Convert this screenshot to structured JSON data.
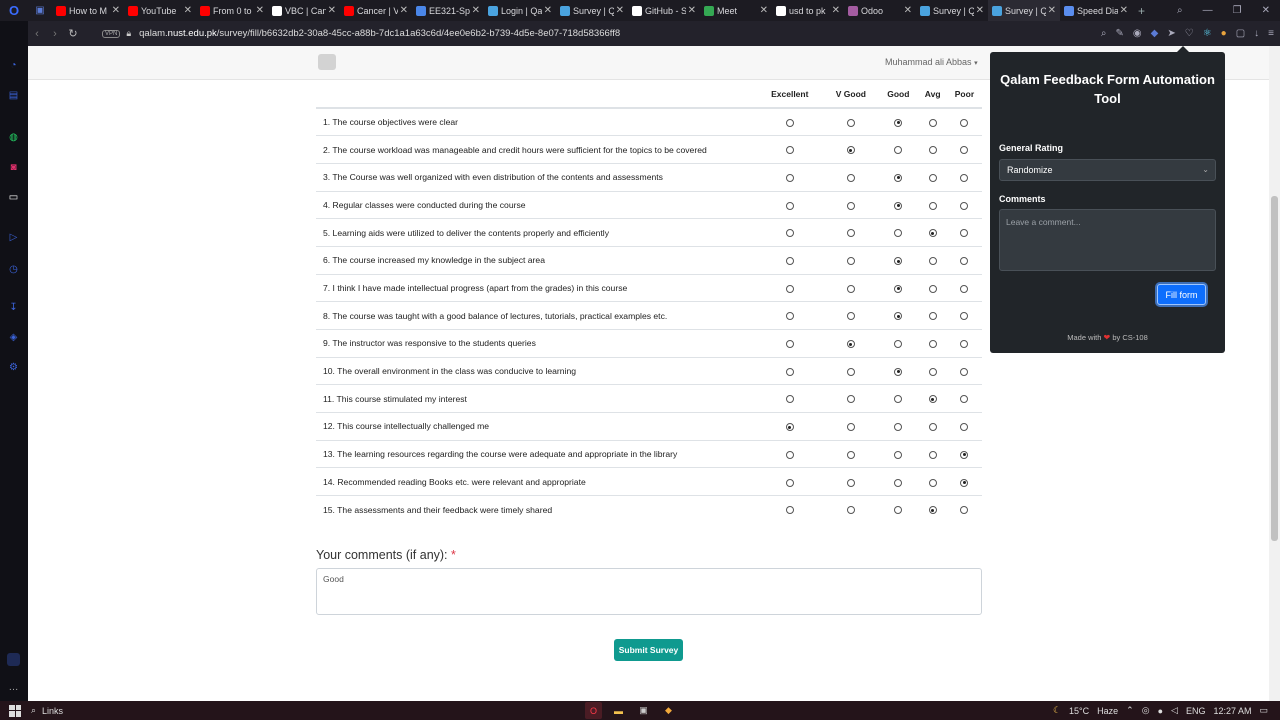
{
  "browser": {
    "tabs": [
      {
        "title": "How to M",
        "color": "#ff0000"
      },
      {
        "title": "YouTube",
        "color": "#ff0000"
      },
      {
        "title": "From 0 to",
        "color": "#ff0000"
      },
      {
        "title": "VBC | Can",
        "color": "#ffffff"
      },
      {
        "title": "Cancer | V",
        "color": "#ff0000"
      },
      {
        "title": "EE321-Sp",
        "color": "#4a86e8"
      },
      {
        "title": "Login | Qa",
        "color": "#4aa3df"
      },
      {
        "title": "Survey | Q",
        "color": "#4aa3df"
      },
      {
        "title": "GitHub - S",
        "color": "#ffffff"
      },
      {
        "title": "Meet",
        "color": "#34a853"
      },
      {
        "title": "usd to pk",
        "color": "#ffffff"
      },
      {
        "title": "Odoo",
        "color": "#a45ca1"
      },
      {
        "title": "Survey | Q",
        "color": "#4aa3df"
      },
      {
        "title": "Survey | Q",
        "color": "#4aa3df",
        "active": true
      },
      {
        "title": "Speed Dia",
        "color": "#5a8dee"
      }
    ],
    "url_prefix": "qalam.",
    "url_domain": "nust.edu.pk",
    "url_path": "/survey/fill/b6632db2-30a8-45cc-a88b-7dc1a1a63c6d/4ee0e6b2-b739-4d5e-8e07-718d58366ff8",
    "vpn_label": "VPN"
  },
  "page": {
    "user_name": "Muhammad ali Abbas",
    "columns": [
      "Excellent",
      "V Good",
      "Good",
      "Avg",
      "Poor"
    ],
    "questions": [
      {
        "text": "1. The course objectives were clear",
        "selected": 2
      },
      {
        "text": "2. The course workload was manageable and credit hours were sufficient for the topics to be covered",
        "selected": 1
      },
      {
        "text": "3. The Course was well organized with even distribution of the contents and assessments",
        "selected": 2
      },
      {
        "text": "4. Regular classes were conducted during the course",
        "selected": 2
      },
      {
        "text": "5. Learning aids were utilized to deliver the contents properly and efficiently",
        "selected": 3
      },
      {
        "text": "6. The course increased my knowledge in the subject area",
        "selected": 2
      },
      {
        "text": "7. I think I have made intellectual progress (apart from the grades) in this course",
        "selected": 2
      },
      {
        "text": "8. The course was taught with a good balance of lectures, tutorials, practical examples etc.",
        "selected": 2
      },
      {
        "text": "9. The instructor was responsive to the students queries",
        "selected": 1
      },
      {
        "text": "10. The overall environment in the class was conducive to learning",
        "selected": 2
      },
      {
        "text": "11. This course stimulated my interest",
        "selected": 3
      },
      {
        "text": "12. This course intellectually challenged me",
        "selected": 0
      },
      {
        "text": "13. The learning resources regarding the course were adequate and appropriate in the library",
        "selected": 4
      },
      {
        "text": "14. Recommended reading Books etc. were relevant and appropriate",
        "selected": 4
      },
      {
        "text": "15. The assessments and their feedback were timely shared",
        "selected": 3
      }
    ],
    "comments_label": "Your comments (if any):",
    "required_mark": "*",
    "comments_value": "Good",
    "submit_label": "Submit Survey"
  },
  "popup": {
    "title": "Qalam Feedback Form Automation Tool",
    "general_rating_label": "General Rating",
    "general_rating_value": "Randomize",
    "comments_label": "Comments",
    "comments_placeholder": "Leave a comment...",
    "fill_button": "Fill form",
    "made_with_prefix": "Made with",
    "made_with_suffix": "by CS-108"
  },
  "taskbar": {
    "links_label": "Links",
    "weather": "15°C",
    "weather_desc": "Haze",
    "language": "ENG",
    "time": "12:27 AM"
  }
}
